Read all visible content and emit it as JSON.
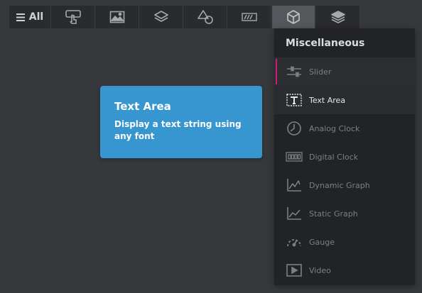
{
  "toolbar": {
    "all_label": "All",
    "buttons": [
      {
        "icon": "interaction-icon"
      },
      {
        "icon": "image-icon"
      },
      {
        "icon": "layers-icon"
      },
      {
        "icon": "shapes-icon"
      },
      {
        "icon": "progress-icon"
      },
      {
        "icon": "cube-icon",
        "active": true
      },
      {
        "icon": "stack-icon"
      }
    ]
  },
  "tooltip": {
    "title": "Text Area",
    "description": "Display a text string using any font"
  },
  "menu": {
    "title": "Miscellaneous",
    "items": [
      {
        "label": "Slider",
        "icon": "slider-icon"
      },
      {
        "label": "Text Area",
        "icon": "text-area-icon"
      },
      {
        "label": "Analog Clock",
        "icon": "analog-clock-icon"
      },
      {
        "label": "Digital Clock",
        "icon": "digital-clock-icon"
      },
      {
        "label": "Dynamic Graph",
        "icon": "dynamic-graph-icon"
      },
      {
        "label": "Static Graph",
        "icon": "static-graph-icon"
      },
      {
        "label": "Gauge",
        "icon": "gauge-icon"
      },
      {
        "label": "Video",
        "icon": "video-icon"
      }
    ]
  },
  "colors": {
    "accent": "#d0187a",
    "tooltip": "#3795cf",
    "background": "#36383c"
  }
}
